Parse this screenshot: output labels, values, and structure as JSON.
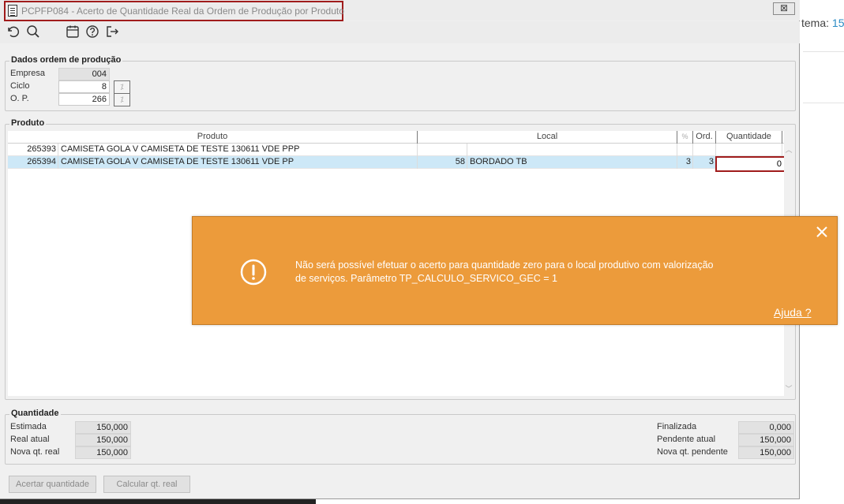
{
  "window": {
    "title": "PCPFP084 - Acerto de Quantidade Real da Ordem de Produção por Produto",
    "close_glyph": "⊠"
  },
  "background_app": {
    "text_prefix": "tema: ",
    "text_number": "15"
  },
  "toolbar": {
    "icons": [
      "undo-icon",
      "search-icon",
      "calendar-icon",
      "help-icon",
      "exit-icon"
    ]
  },
  "dados_ordem": {
    "label": "Dados ordem de produção",
    "empresa_label": "Empresa",
    "empresa_value": "004",
    "ciclo_label": "Ciclo",
    "ciclo_value": "8",
    "op_label": "O. P.",
    "op_value": "266"
  },
  "produto": {
    "label": "Produto",
    "columns": [
      "Produto",
      "Local",
      "%",
      "Ord.",
      "Quantidade"
    ],
    "rows": [
      {
        "code": "265393",
        "description": "CAMISETA GOLA V CAMISETA DE TESTE 130611 VDE PPP",
        "local_code": "",
        "local_name": "",
        "pct": "",
        "ord": "",
        "quantidade": ""
      },
      {
        "code": "265394",
        "description": "CAMISETA GOLA V CAMISETA DE TESTE 130611 VDE PP",
        "local_code": "58",
        "local_name": "BORDADO TB",
        "pct": "3",
        "ord": "3",
        "quantidade": "0"
      }
    ]
  },
  "quantidade": {
    "label": "Quantidade",
    "estimada_label": "Estimada",
    "estimada_value": "150,000",
    "real_atual_label": "Real atual",
    "real_atual_value": "150,000",
    "nova_qt_real_label": "Nova qt. real",
    "nova_qt_real_value": "150,000",
    "finalizada_label": "Finalizada",
    "finalizada_value": "0,000",
    "pendente_atual_label": "Pendente atual",
    "pendente_atual_value": "150,000",
    "nova_qt_pendente_label": "Nova qt. pendente",
    "nova_qt_pendente_value": "150,000"
  },
  "buttons": {
    "acertar": "Acertar quantidade",
    "calcular": "Calcular qt. real"
  },
  "toast": {
    "line1": "Não será possível efetuar o acerto para quantidade zero para o local produtivo com valorização",
    "line2": "de serviços. Parâmetro TP_CALCULO_SERVICO_GEC  = 1",
    "help": "Ajuda ?",
    "bg_color": "#ec9b3b"
  }
}
